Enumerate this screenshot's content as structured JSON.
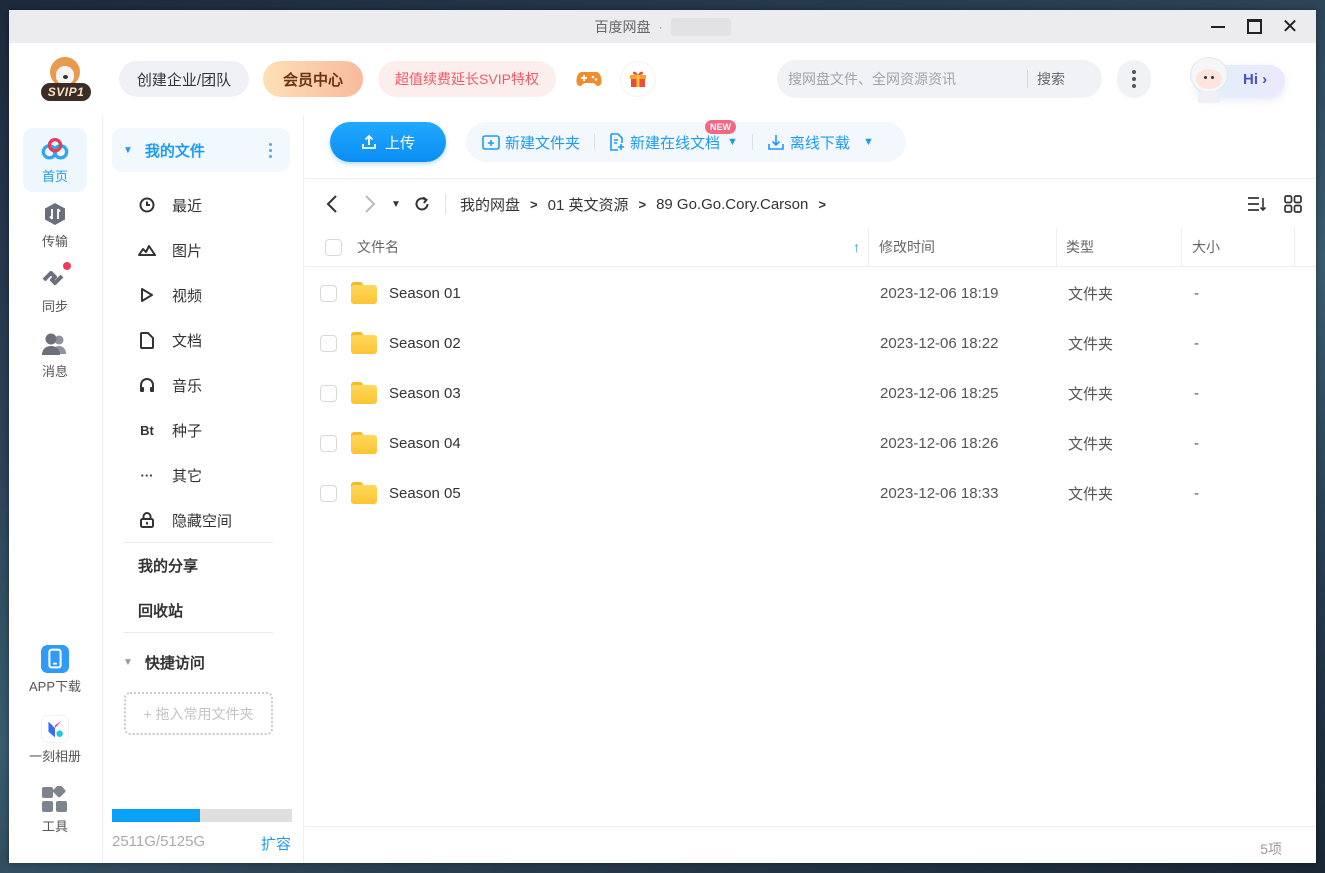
{
  "window": {
    "title": "百度网盘",
    "title_separator": "·"
  },
  "header": {
    "vip_badge": "SVIP1",
    "team_button": "创建企业/团队",
    "vip_center_button": "会员中心",
    "promo_button": "超值续费延长SVIP特权",
    "search": {
      "placeholder": "搜网盘文件、全网资源资讯",
      "value": "",
      "button": "搜索"
    },
    "greeting": "Hi",
    "greeting_arrow": "›"
  },
  "rail": {
    "items": [
      {
        "label": "首页",
        "icon": "home-cloud-icon",
        "active": true
      },
      {
        "label": "传输",
        "icon": "transfer-icon"
      },
      {
        "label": "同步",
        "icon": "sync-icon",
        "badge_dot": true
      },
      {
        "label": "消息",
        "icon": "messages-icon"
      }
    ],
    "bottom_items": [
      {
        "label": "APP下载",
        "icon": "phone-app-icon"
      },
      {
        "label": "一刻相册",
        "icon": "album-app-icon"
      },
      {
        "label": "工具",
        "icon": "tools-icon"
      }
    ]
  },
  "nav": {
    "my_files": "我的文件",
    "items": [
      {
        "label": "最近",
        "icon": "clock-icon"
      },
      {
        "label": "图片",
        "icon": "image-icon"
      },
      {
        "label": "视频",
        "icon": "play-icon"
      },
      {
        "label": "文档",
        "icon": "document-icon"
      },
      {
        "label": "音乐",
        "icon": "headphones-icon"
      },
      {
        "label": "种子",
        "icon": "bt-icon",
        "glyph": "Bt"
      },
      {
        "label": "其它",
        "icon": "more-dots-icon",
        "glyph": "···"
      },
      {
        "label": "隐藏空间",
        "icon": "lock-icon"
      }
    ],
    "my_share": "我的分享",
    "recycle_bin": "回收站",
    "quick_access": "快捷访问",
    "quick_drop_hint": "+ 拖入常用文件夹",
    "storage": {
      "used": "2511G",
      "total": "5125G",
      "text": "2511G/5125G",
      "used_fraction": 0.49,
      "expand": "扩容"
    }
  },
  "toolbar": {
    "upload": "上传",
    "new_folder": "新建文件夹",
    "new_online_doc": "新建在线文档",
    "new_badge": "NEW",
    "offline_download": "离线下载"
  },
  "breadcrumb": {
    "items": [
      "我的网盘",
      "01 英文资源",
      "89 Go.Go.Cory.Carson"
    ],
    "separator": ">"
  },
  "table": {
    "columns": {
      "name": "文件名",
      "modified": "修改时间",
      "type": "类型",
      "size": "大小"
    },
    "sort_indicator": "↑",
    "rows": [
      {
        "name": "Season 01",
        "modified": "2023-12-06 18:19",
        "type": "文件夹",
        "size": "-"
      },
      {
        "name": "Season 02",
        "modified": "2023-12-06 18:22",
        "type": "文件夹",
        "size": "-"
      },
      {
        "name": "Season 03",
        "modified": "2023-12-06 18:25",
        "type": "文件夹",
        "size": "-"
      },
      {
        "name": "Season 04",
        "modified": "2023-12-06 18:26",
        "type": "文件夹",
        "size": "-"
      },
      {
        "name": "Season 05",
        "modified": "2023-12-06 18:33",
        "type": "文件夹",
        "size": "-"
      }
    ]
  },
  "footer": {
    "item_count": "5项"
  },
  "colors": {
    "accent": "#1e9bf0",
    "upload_button": "#0a8df3",
    "storage_fill": "#09a2f8",
    "promo_text": "#f05a6a",
    "badge_red": "#ef3c59",
    "folder_yellow": "#fcc434"
  }
}
